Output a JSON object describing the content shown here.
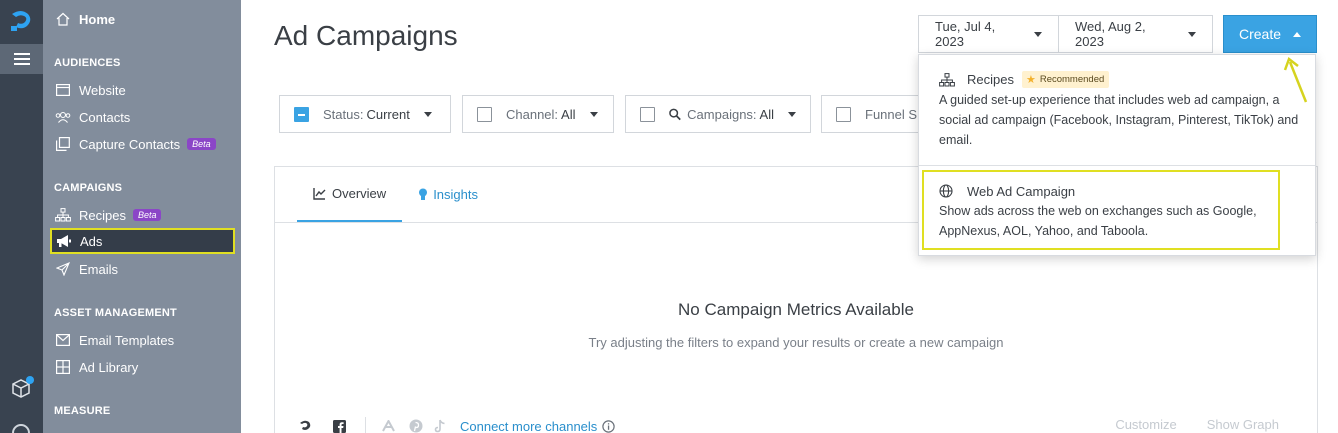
{
  "sidebar": {
    "home": "Home",
    "sections": [
      {
        "title": "AUDIENCES",
        "items": [
          "Website",
          "Contacts",
          "Capture Contacts"
        ]
      },
      {
        "title": "CAMPAIGNS",
        "items": [
          "Recipes",
          "Ads",
          "Emails"
        ]
      },
      {
        "title": "ASSET MANAGEMENT",
        "items": [
          "Email Templates",
          "Ad Library"
        ]
      },
      {
        "title": "MEASURE",
        "items": []
      }
    ],
    "beta_label": "Beta"
  },
  "page": {
    "title": "Ad Campaigns",
    "date_start": "Tue, Jul 4, 2023",
    "date_end": "Wed, Aug 2, 2023",
    "create_label": "Create"
  },
  "filters": {
    "status_label": "Status:",
    "status_value": "Current",
    "channel_label": "Channel:",
    "channel_value": "All",
    "campaigns_label": "Campaigns:",
    "campaigns_value": "All",
    "funnel_label": "Funnel S"
  },
  "tabs": {
    "overview": "Overview",
    "insights": "Insights"
  },
  "empty": {
    "title": "No Campaign Metrics Available",
    "subtitle": "Try adjusting the filters to expand your results or create a new campaign"
  },
  "footer": {
    "connect_label": "Connect more channels",
    "customize": "Customize",
    "show_graph": "Show Graph"
  },
  "dropdown": {
    "recipes_title": "Recipes",
    "recommended": "Recommended",
    "recipes_desc": "A guided set-up experience that includes web ad campaign, a social ad campaign (Facebook, Instagram, Pinterest, TikTok) and email.",
    "web_title": "Web Ad Campaign",
    "web_desc": "Show ads across the web on exchanges such as Google, AppNexus, AOL, Yahoo, and Taboola."
  },
  "colors": {
    "accent": "#3aa3e3",
    "highlight": "#e0df22",
    "beta": "#8b46c7"
  }
}
